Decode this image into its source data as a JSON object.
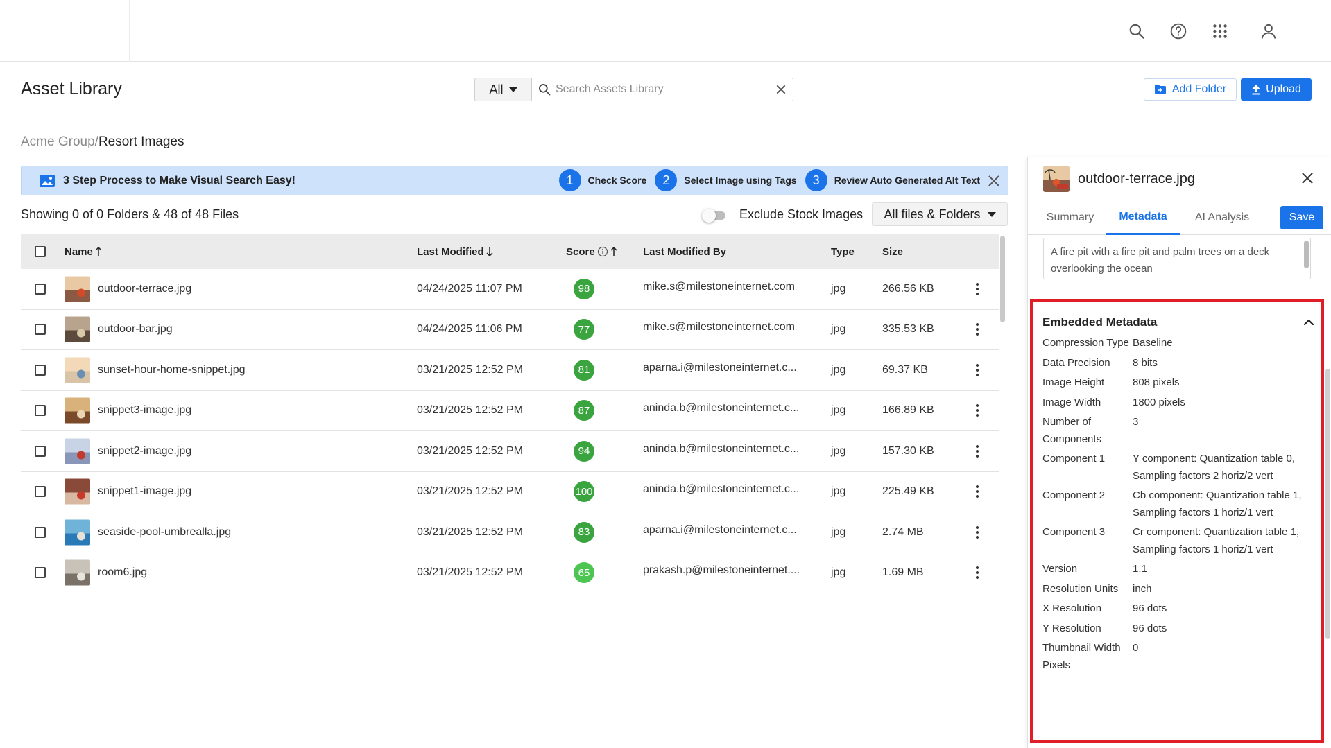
{
  "topbar": {
    "icons": [
      "search-icon",
      "help-icon",
      "apps-grid-icon",
      "user-icon"
    ]
  },
  "header": {
    "title": "Asset Library",
    "scope_value": "All",
    "search_placeholder": "Search Assets Library",
    "add_folder_label": "Add Folder",
    "upload_label": "Upload"
  },
  "breadcrumb": {
    "parent": "Acme Group/",
    "current": "Resort Images"
  },
  "banner": {
    "title": "3 Step Process to Make Visual Search Easy!",
    "steps": [
      {
        "num": "1",
        "label": "Check Score"
      },
      {
        "num": "2",
        "label": "Select Image using Tags"
      },
      {
        "num": "3",
        "label": "Review Auto Generated Alt Text"
      }
    ]
  },
  "listing": {
    "showing": "Showing 0 of 0 Folders & 48 of 48 Files",
    "exclude_label": "Exclude Stock Images",
    "exclude_on": false,
    "filter_value": "All files & Folders"
  },
  "table": {
    "columns": {
      "name": "Name",
      "modified": "Last Modified",
      "score": "Score",
      "modified_by": "Last Modified By",
      "type": "Type",
      "size": "Size"
    },
    "rows": [
      {
        "name": "outdoor-terrace.jpg",
        "modified": "04/24/2025 11:07 PM",
        "score": "98",
        "score_color": "#3aa53e",
        "by": "mike.s@milestoneinternet.com",
        "type": "jpg",
        "size": "266.56 KB"
      },
      {
        "name": "outdoor-bar.jpg",
        "modified": "04/24/2025 11:06 PM",
        "score": "77",
        "score_color": "#3aa53e",
        "by": "mike.s@milestoneinternet.com",
        "type": "jpg",
        "size": "335.53 KB"
      },
      {
        "name": "sunset-hour-home-snippet.jpg",
        "modified": "03/21/2025 12:52 PM",
        "score": "81",
        "score_color": "#3aa53e",
        "by": "aparna.i@milestoneinternet.c...",
        "type": "jpg",
        "size": "69.37 KB"
      },
      {
        "name": "snippet3-image.jpg",
        "modified": "03/21/2025 12:52 PM",
        "score": "87",
        "score_color": "#3aa53e",
        "by": "aninda.b@milestoneinternet.c...",
        "type": "jpg",
        "size": "166.89 KB"
      },
      {
        "name": "snippet2-image.jpg",
        "modified": "03/21/2025 12:52 PM",
        "score": "94",
        "score_color": "#3aa53e",
        "by": "aninda.b@milestoneinternet.c...",
        "type": "jpg",
        "size": "157.30 KB"
      },
      {
        "name": "snippet1-image.jpg",
        "modified": "03/21/2025 12:52 PM",
        "score": "100",
        "score_color": "#3aa53e",
        "by": "aninda.b@milestoneinternet.c...",
        "type": "jpg",
        "size": "225.49 KB"
      },
      {
        "name": "seaside-pool-umbrealla.jpg",
        "modified": "03/21/2025 12:52 PM",
        "score": "83",
        "score_color": "#3aa53e",
        "by": "aparna.i@milestoneinternet.c...",
        "type": "jpg",
        "size": "2.74 MB"
      },
      {
        "name": "room6.jpg",
        "modified": "03/21/2025 12:52 PM",
        "score": "65",
        "score_color": "#4cc552",
        "by": "prakash.p@milestoneinternet....",
        "type": "jpg",
        "size": "1.69 MB"
      }
    ]
  },
  "panel": {
    "file_name": "outdoor-terrace.jpg",
    "tabs": [
      "Summary",
      "Metadata",
      "AI Analysis"
    ],
    "active_tab": "Metadata",
    "save_label": "Save",
    "alt_text": "A fire pit with a fire pit and palm trees on a deck overlooking the ocean",
    "metadata_title": "Embedded Metadata",
    "metadata": [
      {
        "k": "Compression Type",
        "v": "Baseline"
      },
      {
        "k": "Data Precision",
        "v": "8 bits"
      },
      {
        "k": "Image Height",
        "v": "808 pixels"
      },
      {
        "k": "Image Width",
        "v": "1800 pixels"
      },
      {
        "k": "Number of Components",
        "v": "3"
      },
      {
        "k": "Component 1",
        "v": "Y component: Quantization table 0, Sampling factors 2 horiz/2 vert"
      },
      {
        "k": "Component 2",
        "v": "Cb component: Quantization table 1, Sampling factors 1 horiz/1 vert"
      },
      {
        "k": "Component 3",
        "v": "Cr component: Quantization table 1, Sampling factors 1 horiz/1 vert"
      },
      {
        "k": "Version",
        "v": "1.1"
      },
      {
        "k": "Resolution Units",
        "v": "inch"
      },
      {
        "k": "X Resolution",
        "v": "96 dots"
      },
      {
        "k": "Y Resolution",
        "v": "96 dots"
      },
      {
        "k": "Thumbnail Width Pixels",
        "v": "0"
      }
    ]
  },
  "colors": {
    "accent": "#1a73e8",
    "banner_bg": "#cfe2fb",
    "highlight_border": "#e01e27"
  }
}
